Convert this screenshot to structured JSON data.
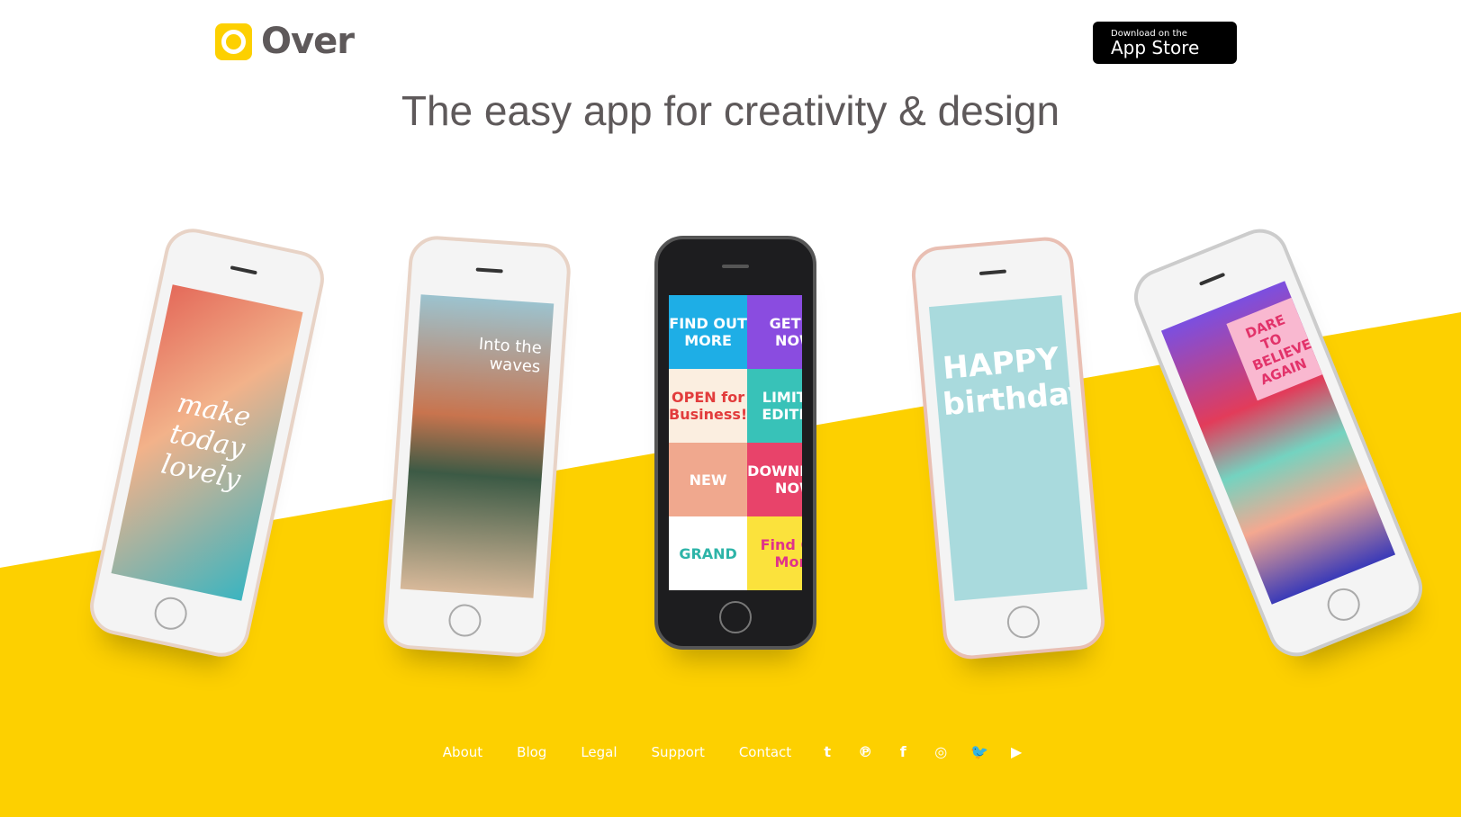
{
  "brand": {
    "name": "Over",
    "accent": "#fdd000",
    "text_color": "#5e595a"
  },
  "appstore": {
    "line1": "Download on the",
    "line2": "App Store",
    "icon": "apple-icon"
  },
  "headline": "The easy app for creativity & design",
  "phones": [
    {
      "screen": "make today lovely"
    },
    {
      "screen": "Into the waves"
    },
    {
      "tiles": [
        "FIND OUT MORE",
        "GET IT NOW",
        "OPEN for Business!",
        "LIMITED EDITION",
        "NEW",
        "DOWNLOAD NOW",
        "GRAND",
        "Find Out More"
      ]
    },
    {
      "screen": "HAPPY birthday"
    },
    {
      "screen": "DARE TO BELIEVE AGAIN"
    }
  ],
  "footer": {
    "links": [
      "About",
      "Blog",
      "Legal",
      "Support",
      "Contact"
    ],
    "social": [
      {
        "icon": "tumblr-icon",
        "glyph": "t"
      },
      {
        "icon": "pinterest-icon",
        "glyph": "℗"
      },
      {
        "icon": "facebook-icon",
        "glyph": "f"
      },
      {
        "icon": "instagram-icon",
        "glyph": "◎"
      },
      {
        "icon": "twitter-icon",
        "glyph": "🐦"
      },
      {
        "icon": "youtube-icon",
        "glyph": "▶"
      }
    ]
  }
}
